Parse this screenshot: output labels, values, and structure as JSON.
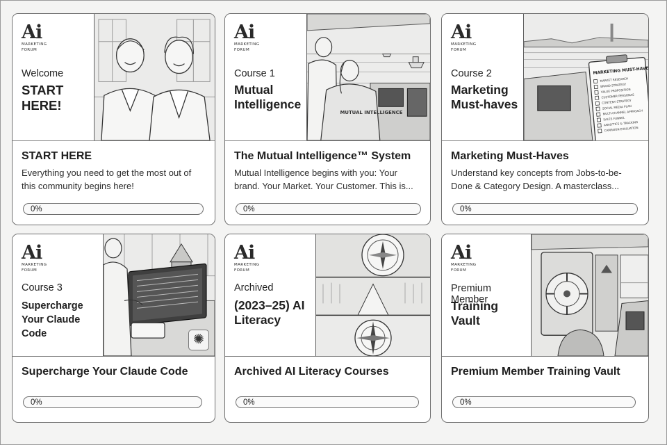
{
  "logo": {
    "mark": "Ai",
    "line1": "MARKETING",
    "line2": "FORUM"
  },
  "courses": [
    {
      "kicker": "Welcome",
      "thumb_title": "START HERE!",
      "title": "START HERE",
      "description": "Everything you need to get the most out of this community begins here!",
      "progress_label": "0%",
      "progress": 0
    },
    {
      "kicker": "Course 1",
      "thumb_title": "Mutual Intelligence",
      "title": "The Mutual Intelligence™ System",
      "description": "Mutual Intelligence begins with you: Your brand. Your Market. Your Customer. This is...",
      "progress_label": "0%",
      "progress": 0
    },
    {
      "kicker": "Course 2",
      "thumb_title": "Marketing Must-haves",
      "title": "Marketing Must-Haves",
      "description": "Understand key concepts from Jobs-to-be-Done & Category Design. A masterclass...",
      "progress_label": "0%",
      "progress": 0
    },
    {
      "kicker": "Course 3",
      "thumb_title": "Supercharge Your Claude Code",
      "title": "Supercharge Your Claude Code",
      "description": "",
      "progress_label": "0%",
      "progress": 0
    },
    {
      "kicker": "Archived",
      "thumb_title": "(2023–25) AI Literacy",
      "title": "Archived AI Literacy Courses",
      "description": "",
      "progress_label": "0%",
      "progress": 0
    },
    {
      "kicker": "Premium Member",
      "thumb_title": "Training Vault",
      "title": "Premium Member Training Vault",
      "description": "",
      "progress_label": "0%",
      "progress": 0
    }
  ],
  "thumb_decor": {
    "mutual_jacket": "MUTUAL INTELLIGENCE",
    "clipboard_title": "MARKETING MUST-HAVES",
    "checklist": [
      "MARKET RESEARCH",
      "BRAND STRATEGY",
      "VALUE PROPOSITION",
      "CUSTOMER PERSONAS",
      "CONTENT STRATEGY",
      "SOCIAL MEDIA PLAN",
      "MULTI-CHANNEL APPROACH",
      "SALES FUNNEL",
      "ANALYTICS & TRACKING",
      "CAMPAIGN EVALUATION"
    ]
  },
  "colors": {
    "ink": "#1f1f1f",
    "border": "#6f6f6f",
    "paper": "#ffffff",
    "sketch": "#e9e9e7"
  }
}
